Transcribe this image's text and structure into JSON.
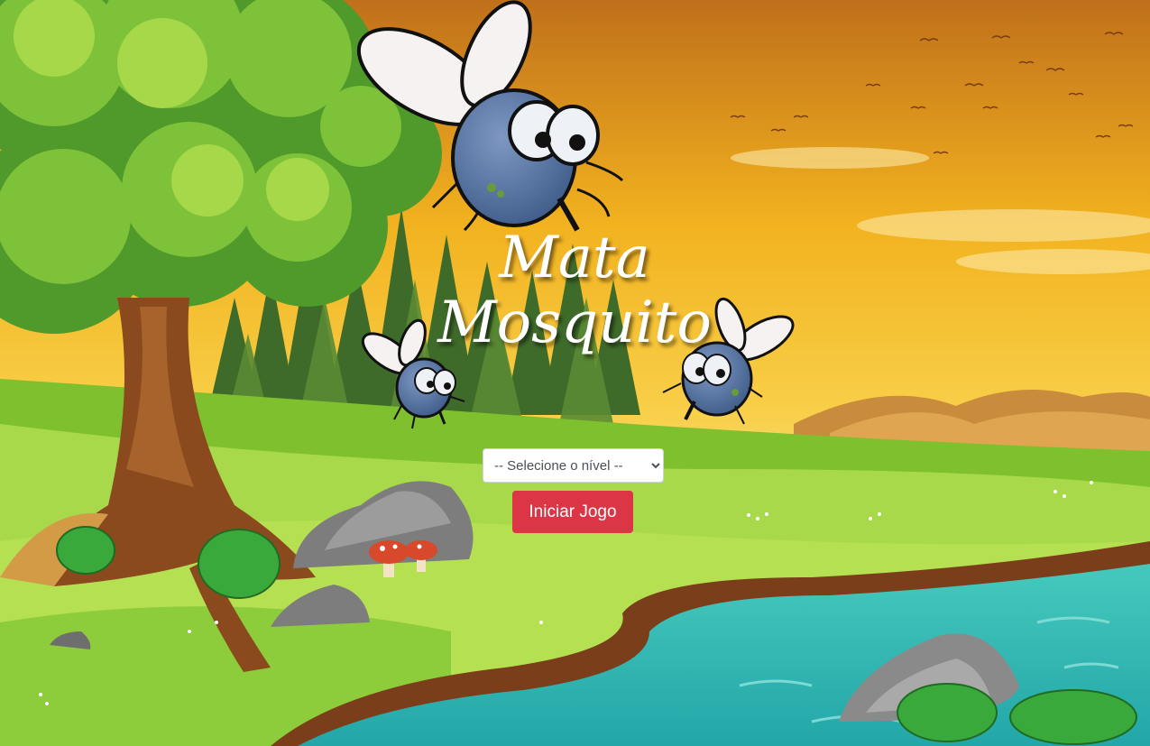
{
  "game": {
    "title_line1": "Mata",
    "title_line2": "Mosquito",
    "level_select": {
      "selected": "-- Selecione o nível --"
    },
    "start_button_label": "Iniciar Jogo"
  },
  "colors": {
    "start_button": "#dc3545",
    "title_text": "#ffffff",
    "mosquito_body": "#5b77a3",
    "river": "#2fb8b0"
  }
}
